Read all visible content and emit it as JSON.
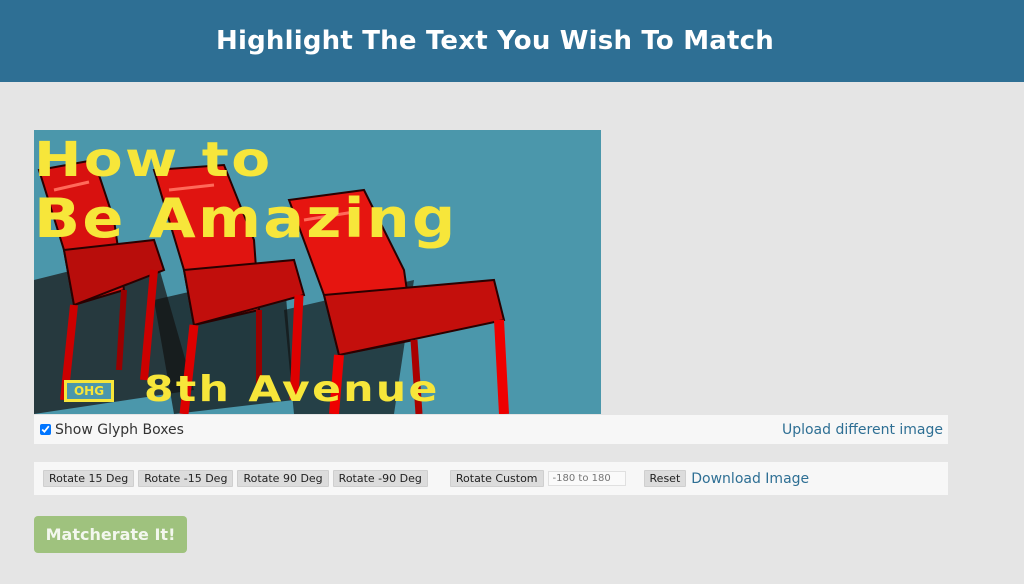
{
  "header": {
    "title": "Highlight The Text You Wish To Match"
  },
  "image": {
    "title_line1": "How to",
    "title_line2": "Be Amazing",
    "logo_text": "OHG",
    "bottom_text": "8th Avenue",
    "colors": {
      "background": "#4b97ab",
      "text": "#f7e63a",
      "chairs": "#d8110f"
    }
  },
  "glyph": {
    "checkbox_checked": true,
    "checkbox_label": "Show Glyph Boxes",
    "upload_link": "Upload different image"
  },
  "toolbar": {
    "rotate_15": "Rotate 15 Deg",
    "rotate_neg15": "Rotate -15 Deg",
    "rotate_90": "Rotate 90 Deg",
    "rotate_neg90": "Rotate -90 Deg",
    "rotate_custom": "Rotate Custom",
    "custom_placeholder": "-180 to 180",
    "reset": "Reset",
    "download": "Download Image"
  },
  "submit": {
    "label": "Matcherate It!"
  },
  "colors": {
    "header_bg": "#2e6f94",
    "page_bg": "#e5e5e5",
    "link": "#2e6f94",
    "submit_bg": "#9fc27e"
  }
}
